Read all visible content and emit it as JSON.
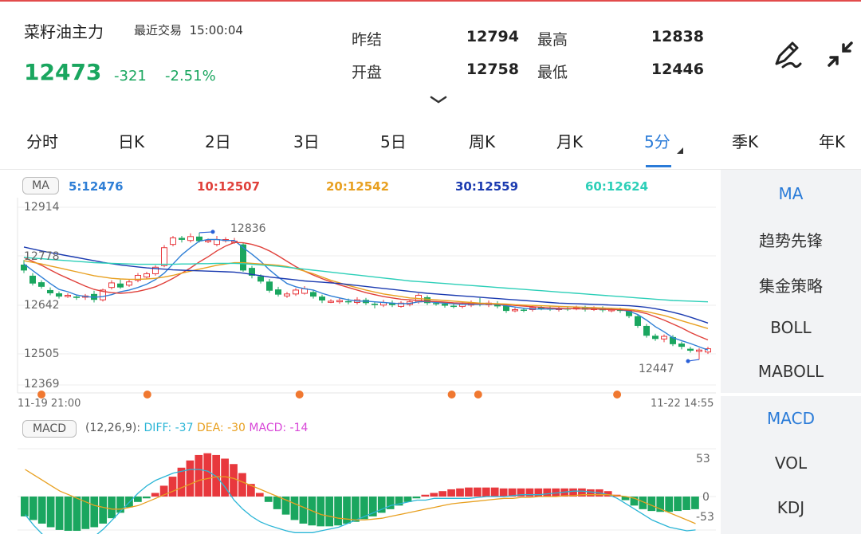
{
  "header": {
    "title": "菜籽油主力",
    "status_text": "最近交易",
    "time": "15:00:04",
    "price": "12473",
    "change": "-321",
    "change_pct": "-2.51%",
    "stats": [
      {
        "label": "昨结",
        "value": "12794"
      },
      {
        "label": "最高",
        "value": "12838"
      },
      {
        "label": "开盘",
        "value": "12758"
      },
      {
        "label": "最低",
        "value": "12446"
      }
    ]
  },
  "tabs": [
    "分时",
    "日K",
    "2日",
    "3日",
    "5日",
    "周K",
    "月K",
    "5分",
    "季K",
    "年K"
  ],
  "active_tab": "5分",
  "ma_bar": {
    "pill": "MA",
    "items": [
      {
        "label": "5:12476",
        "color": "#2f7fd6"
      },
      {
        "label": "10:12507",
        "color": "#e0403a"
      },
      {
        "label": "20:12542",
        "color": "#e8a020"
      },
      {
        "label": "30:12559",
        "color": "#1a3ab0"
      },
      {
        "label": "60:12624",
        "color": "#2ccfb8"
      }
    ]
  },
  "price_axis": [
    "12914",
    "12778",
    "12642",
    "12505",
    "12369"
  ],
  "time_axis": {
    "start": "11-19 21:00",
    "end": "11-22 14:55"
  },
  "markers": {
    "high": "12836",
    "low": "12447"
  },
  "macd_bar": {
    "pill": "MACD",
    "params": "(12,26,9):",
    "diff": "DIFF: -37",
    "dea": "DEA: -30",
    "macd": "MACD: -14"
  },
  "macd_axis": [
    "53",
    "0",
    "-53"
  ],
  "side_main": [
    "MA",
    "趋势先锋",
    "集金策略",
    "BOLL",
    "MABOLL"
  ],
  "side_sub": [
    "MACD",
    "VOL",
    "KDJ"
  ],
  "colors": {
    "up": "#e8383d",
    "down": "#1aa65f",
    "accent": "#2a7bd8"
  },
  "chart_data": {
    "type": "candlestick",
    "candles": [
      {
        "o": 12738,
        "c": 12720,
        "h": 12752,
        "l": 12712
      },
      {
        "o": 12704,
        "c": 12680,
        "h": 12712,
        "l": 12674
      },
      {
        "o": 12684,
        "c": 12670,
        "h": 12690,
        "l": 12664
      },
      {
        "o": 12660,
        "c": 12650,
        "h": 12668,
        "l": 12644
      },
      {
        "o": 12650,
        "c": 12640,
        "h": 12656,
        "l": 12634
      },
      {
        "o": 12642,
        "c": 12644,
        "h": 12650,
        "l": 12636
      },
      {
        "o": 12640,
        "c": 12636,
        "h": 12646,
        "l": 12630
      },
      {
        "o": 12638,
        "c": 12642,
        "h": 12648,
        "l": 12630
      },
      {
        "o": 12648,
        "c": 12630,
        "h": 12658,
        "l": 12622
      },
      {
        "o": 12630,
        "c": 12660,
        "h": 12664,
        "l": 12625
      },
      {
        "o": 12668,
        "c": 12682,
        "h": 12690,
        "l": 12662
      },
      {
        "o": 12680,
        "c": 12668,
        "h": 12692,
        "l": 12664
      },
      {
        "o": 12675,
        "c": 12685,
        "h": 12692,
        "l": 12670
      },
      {
        "o": 12690,
        "c": 12705,
        "h": 12712,
        "l": 12684
      },
      {
        "o": 12700,
        "c": 12710,
        "h": 12716,
        "l": 12694
      },
      {
        "o": 12710,
        "c": 12730,
        "h": 12736,
        "l": 12704
      },
      {
        "o": 12735,
        "c": 12790,
        "h": 12798,
        "l": 12730
      },
      {
        "o": 12800,
        "c": 12820,
        "h": 12826,
        "l": 12794
      },
      {
        "o": 12820,
        "c": 12814,
        "h": 12826,
        "l": 12806
      },
      {
        "o": 12812,
        "c": 12824,
        "h": 12834,
        "l": 12806
      },
      {
        "o": 12824,
        "c": 12810,
        "h": 12836,
        "l": 12806
      },
      {
        "o": 12812,
        "c": 12812,
        "h": 12818,
        "l": 12804
      },
      {
        "o": 12800,
        "c": 12815,
        "h": 12826,
        "l": 12794
      },
      {
        "o": 12812,
        "c": 12815,
        "h": 12822,
        "l": 12806
      },
      {
        "o": 12808,
        "c": 12810,
        "h": 12820,
        "l": 12802
      },
      {
        "o": 12800,
        "c": 12720,
        "h": 12806,
        "l": 12716
      },
      {
        "o": 12728,
        "c": 12704,
        "h": 12734,
        "l": 12696
      },
      {
        "o": 12702,
        "c": 12686,
        "h": 12708,
        "l": 12680
      },
      {
        "o": 12686,
        "c": 12658,
        "h": 12694,
        "l": 12652
      },
      {
        "o": 12662,
        "c": 12646,
        "h": 12670,
        "l": 12640
      },
      {
        "o": 12642,
        "c": 12648,
        "h": 12654,
        "l": 12636
      },
      {
        "o": 12648,
        "c": 12660,
        "h": 12666,
        "l": 12642
      },
      {
        "o": 12650,
        "c": 12664,
        "h": 12672,
        "l": 12646
      },
      {
        "o": 12654,
        "c": 12640,
        "h": 12660,
        "l": 12634
      },
      {
        "o": 12640,
        "c": 12628,
        "h": 12646,
        "l": 12620
      },
      {
        "o": 12626,
        "c": 12626,
        "h": 12632,
        "l": 12620
      },
      {
        "o": 12624,
        "c": 12628,
        "h": 12636,
        "l": 12618
      },
      {
        "o": 12626,
        "c": 12624,
        "h": 12634,
        "l": 12616
      },
      {
        "o": 12622,
        "c": 12630,
        "h": 12638,
        "l": 12616
      },
      {
        "o": 12630,
        "c": 12620,
        "h": 12636,
        "l": 12614
      },
      {
        "o": 12618,
        "c": 12614,
        "h": 12624,
        "l": 12604
      },
      {
        "o": 12614,
        "c": 12622,
        "h": 12630,
        "l": 12608
      },
      {
        "o": 12620,
        "c": 12614,
        "h": 12628,
        "l": 12608
      },
      {
        "o": 12610,
        "c": 12620,
        "h": 12626,
        "l": 12606
      },
      {
        "o": 12616,
        "c": 12624,
        "h": 12630,
        "l": 12610
      },
      {
        "o": 12624,
        "c": 12644,
        "h": 12650,
        "l": 12618
      },
      {
        "o": 12638,
        "c": 12620,
        "h": 12644,
        "l": 12614
      },
      {
        "o": 12620,
        "c": 12618,
        "h": 12626,
        "l": 12612
      },
      {
        "o": 12618,
        "c": 12612,
        "h": 12624,
        "l": 12606
      },
      {
        "o": 12612,
        "c": 12610,
        "h": 12620,
        "l": 12604
      },
      {
        "o": 12610,
        "c": 12616,
        "h": 12622,
        "l": 12604
      },
      {
        "o": 12614,
        "c": 12620,
        "h": 12628,
        "l": 12608
      },
      {
        "o": 12620,
        "c": 12615,
        "h": 12636,
        "l": 12610
      },
      {
        "o": 12615,
        "c": 12620,
        "h": 12628,
        "l": 12608
      },
      {
        "o": 12618,
        "c": 12610,
        "h": 12626,
        "l": 12604
      },
      {
        "o": 12612,
        "c": 12596,
        "h": 12616,
        "l": 12590
      },
      {
        "o": 12598,
        "c": 12600,
        "h": 12606,
        "l": 12592
      },
      {
        "o": 12600,
        "c": 12598,
        "h": 12606,
        "l": 12592
      },
      {
        "o": 12600,
        "c": 12606,
        "h": 12612,
        "l": 12594
      },
      {
        "o": 12606,
        "c": 12604,
        "h": 12612,
        "l": 12598
      },
      {
        "o": 12604,
        "c": 12600,
        "h": 12610,
        "l": 12596
      },
      {
        "o": 12600,
        "c": 12604,
        "h": 12610,
        "l": 12594
      },
      {
        "o": 12604,
        "c": 12602,
        "h": 12610,
        "l": 12596
      },
      {
        "o": 12602,
        "c": 12606,
        "h": 12612,
        "l": 12598
      },
      {
        "o": 12606,
        "c": 12600,
        "h": 12612,
        "l": 12594
      },
      {
        "o": 12600,
        "c": 12604,
        "h": 12610,
        "l": 12596
      },
      {
        "o": 12604,
        "c": 12598,
        "h": 12610,
        "l": 12592
      },
      {
        "o": 12598,
        "c": 12600,
        "h": 12606,
        "l": 12592
      },
      {
        "o": 12600,
        "c": 12596,
        "h": 12606,
        "l": 12590
      },
      {
        "o": 12596,
        "c": 12580,
        "h": 12600,
        "l": 12574
      },
      {
        "o": 12580,
        "c": 12550,
        "h": 12586,
        "l": 12544
      },
      {
        "o": 12550,
        "c": 12520,
        "h": 12556,
        "l": 12514
      },
      {
        "o": 12520,
        "c": 12510,
        "h": 12526,
        "l": 12504
      },
      {
        "o": 12510,
        "c": 12518,
        "h": 12524,
        "l": 12500
      },
      {
        "o": 12516,
        "c": 12494,
        "h": 12522,
        "l": 12488
      },
      {
        "o": 12496,
        "c": 12486,
        "h": 12502,
        "l": 12478
      },
      {
        "o": 12480,
        "c": 12474,
        "h": 12486,
        "l": 12468
      },
      {
        "o": 12472,
        "c": 12476,
        "h": 12482,
        "l": 12447
      },
      {
        "o": 12470,
        "c": 12480,
        "h": 12486,
        "l": 12464
      }
    ],
    "ma": [
      {
        "name": "MA5",
        "color": "#2f7fd6",
        "values": [
          12740,
          12720,
          12700,
          12680,
          12662,
          12655,
          12645,
          12640,
          12638,
          12640,
          12646,
          12655,
          12660,
          12668,
          12678,
          12692,
          12712,
          12740,
          12768,
          12790,
          12810,
          12815,
          12815,
          12812,
          12812,
          12790,
          12770,
          12748,
          12722,
          12700,
          12680,
          12670,
          12664,
          12660,
          12650,
          12642,
          12636,
          12630,
          12626,
          12626,
          12624,
          12622,
          12620,
          12618,
          12619,
          12624,
          12625,
          12622,
          12620,
          12618,
          12616,
          12616,
          12616,
          12617,
          12616,
          12612,
          12608,
          12604,
          12602,
          12602,
          12602,
          12602,
          12603,
          12603,
          12603,
          12603,
          12602,
          12601,
          12600,
          12595,
          12585,
          12568,
          12548,
          12532,
          12514,
          12505,
          12496,
          12486,
          12476
        ]
      },
      {
        "name": "MA10",
        "color": "#e0403a",
        "values": [
          12760,
          12748,
          12736,
          12722,
          12708,
          12696,
          12684,
          12672,
          12662,
          12656,
          12652,
          12650,
          12652,
          12656,
          12662,
          12670,
          12682,
          12696,
          12712,
          12728,
          12746,
          12762,
          12780,
          12795,
          12806,
          12805,
          12800,
          12792,
          12780,
          12765,
          12748,
          12732,
          12718,
          12706,
          12695,
          12685,
          12676,
          12668,
          12660,
          12652,
          12646,
          12640,
          12636,
          12632,
          12630,
          12628,
          12626,
          12625,
          12623,
          12621,
          12620,
          12619,
          12618,
          12618,
          12617,
          12615,
          12613,
          12611,
          12609,
          12607,
          12605,
          12604,
          12603,
          12603,
          12602,
          12602,
          12601,
          12600,
          12600,
          12598,
          12594,
          12588,
          12578,
          12568,
          12556,
          12544,
          12530,
          12518,
          12507
        ]
      },
      {
        "name": "MA20",
        "color": "#e8a020",
        "values": [
          12750,
          12745,
          12740,
          12734,
          12728,
          12722,
          12716,
          12710,
          12704,
          12700,
          12696,
          12694,
          12693,
          12693,
          12694,
          12696,
          12700,
          12705,
          12712,
          12718,
          12724,
          12730,
          12736,
          12740,
          12744,
          12744,
          12742,
          12740,
          12738,
          12736,
          12732,
          12726,
          12718,
          12710,
          12700,
          12690,
          12682,
          12674,
          12667,
          12660,
          12654,
          12648,
          12644,
          12640,
          12636,
          12634,
          12632,
          12630,
          12628,
          12626,
          12624,
          12622,
          12620,
          12619,
          12618,
          12617,
          12615,
          12614,
          12613,
          12612,
          12611,
          12610,
          12609,
          12608,
          12607,
          12606,
          12605,
          12604,
          12603,
          12601,
          12598,
          12594,
          12588,
          12582,
          12574,
          12566,
          12558,
          12550,
          12542
        ]
      },
      {
        "name": "MA30",
        "color": "#1a3ab0",
        "values": [
          12792,
          12786,
          12780,
          12775,
          12770,
          12765,
          12760,
          12755,
          12750,
          12745,
          12741,
          12737,
          12734,
          12731,
          12728,
          12726,
          12724,
          12722,
          12721,
          12720,
          12719,
          12718,
          12717,
          12716,
          12715,
          12712,
          12708,
          12704,
          12700,
          12697,
          12694,
          12691,
          12688,
          12686,
          12684,
          12682,
          12680,
          12677,
          12674,
          12671,
          12668,
          12665,
          12662,
          12659,
          12656,
          12653,
          12650,
          12648,
          12646,
          12644,
          12642,
          12640,
          12638,
          12636,
          12634,
          12632,
          12630,
          12628,
          12626,
          12624,
          12622,
          12620,
          12619,
          12618,
          12617,
          12616,
          12615,
          12614,
          12613,
          12612,
          12610,
          12607,
          12603,
          12598,
          12592,
          12585,
          12577,
          12568,
          12559
        ]
      },
      {
        "name": "MA60",
        "color": "#2ccfb8",
        "values": [
          12760,
          12758,
          12756,
          12754,
          12752,
          12750,
          12748,
          12746,
          12744,
          12743,
          12742,
          12741,
          12740,
          12739,
          12739,
          12739,
          12739,
          12739,
          12740,
          12740,
          12741,
          12741,
          12742,
          12742,
          12742,
          12741,
          12739,
          12737,
          12735,
          12733,
          12730,
          12727,
          12724,
          12721,
          12718,
          12715,
          12712,
          12709,
          12706,
          12703,
          12700,
          12697,
          12694,
          12691,
          12688,
          12686,
          12684,
          12682,
          12680,
          12678,
          12676,
          12674,
          12672,
          12670,
          12668,
          12666,
          12664,
          12662,
          12660,
          12658,
          12656,
          12654,
          12652,
          12650,
          12648,
          12646,
          12644,
          12642,
          12640,
          12638,
          12636,
          12634,
          12632,
          12630,
          12628,
          12627,
          12626,
          12625,
          12624
        ]
      }
    ],
    "macd": {
      "hist": [
        -22,
        -26,
        -30,
        -34,
        -37,
        -38,
        -38,
        -36,
        -34,
        -30,
        -24,
        -18,
        -12,
        -6,
        -2,
        4,
        12,
        22,
        32,
        40,
        46,
        48,
        46,
        42,
        36,
        26,
        14,
        4,
        -6,
        -14,
        -20,
        -26,
        -30,
        -32,
        -33,
        -33,
        -32,
        -30,
        -28,
        -25,
        -22,
        -18,
        -14,
        -10,
        -6,
        -2,
        2,
        4,
        6,
        8,
        9,
        10,
        10,
        10,
        10,
        9,
        9,
        9,
        9,
        9,
        9,
        9,
        9,
        9,
        9,
        8,
        8,
        6,
        2,
        -4,
        -10,
        -14,
        -16,
        -17,
        -17,
        -16,
        -15,
        -14
      ],
      "diff": [
        -20,
        -32,
        -42,
        -50,
        -54,
        -56,
        -54,
        -50,
        -44,
        -36,
        -26,
        -16,
        -6,
        4,
        12,
        18,
        22,
        26,
        28,
        30,
        30,
        28,
        22,
        10,
        -4,
        -14,
        -22,
        -28,
        -32,
        -35,
        -38,
        -40,
        -40,
        -40,
        -38,
        -36,
        -34,
        -30,
        -26,
        -22,
        -18,
        -14,
        -10,
        -8,
        -6,
        -4,
        -4,
        -2,
        -2,
        -2,
        -2,
        -2,
        -1,
        0,
        0,
        0,
        1,
        2,
        2,
        2,
        3,
        4,
        5,
        6,
        6,
        5,
        4,
        2,
        -2,
        -8,
        -14,
        -20,
        -26,
        -30,
        -34,
        -36,
        -38,
        -37
      ],
      "dea": [
        30,
        24,
        18,
        12,
        6,
        2,
        -2,
        -6,
        -10,
        -12,
        -14,
        -14,
        -12,
        -10,
        -6,
        -2,
        2,
        6,
        10,
        14,
        18,
        20,
        22,
        22,
        20,
        16,
        12,
        8,
        4,
        0,
        -4,
        -8,
        -12,
        -16,
        -20,
        -22,
        -24,
        -25,
        -26,
        -26,
        -25,
        -24,
        -22,
        -20,
        -18,
        -16,
        -14,
        -12,
        -10,
        -8,
        -7,
        -6,
        -5,
        -4,
        -3,
        -2,
        -2,
        -1,
        -1,
        0,
        0,
        0,
        1,
        1,
        2,
        2,
        2,
        2,
        1,
        0,
        -2,
        -6,
        -10,
        -14,
        -18,
        -22,
        -26,
        -30
      ]
    }
  }
}
